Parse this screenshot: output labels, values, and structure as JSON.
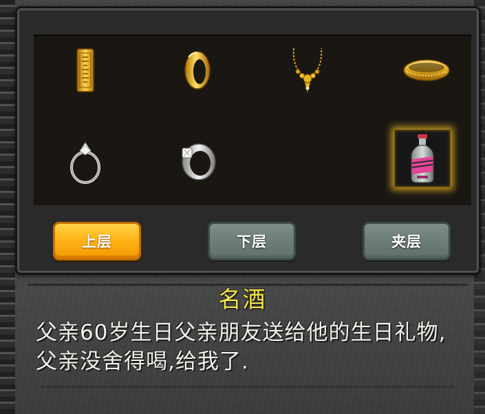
{
  "inventory": {
    "items": [
      {
        "icon": "gold-bar-icon"
      },
      {
        "icon": "gold-ring-icon"
      },
      {
        "icon": "gold-necklace-icon"
      },
      {
        "icon": "gold-bracelet-icon"
      },
      {
        "icon": "diamond-ring-icon"
      },
      {
        "icon": "silver-ring-icon"
      },
      {
        "icon": "empty-slot"
      },
      {
        "icon": "liquor-bottle-icon",
        "selected": true
      }
    ],
    "selected_color": "#ffc428"
  },
  "tabs": {
    "upper": "上层",
    "lower": "下层",
    "middle": "夹层",
    "active": "upper",
    "active_color": "#ffb516",
    "normal_color": "#6c7e76"
  },
  "detail": {
    "name": "名酒",
    "description": "父亲60岁生日父亲朋友送给他的生日礼物,父亲没舍得喝,给我了."
  }
}
